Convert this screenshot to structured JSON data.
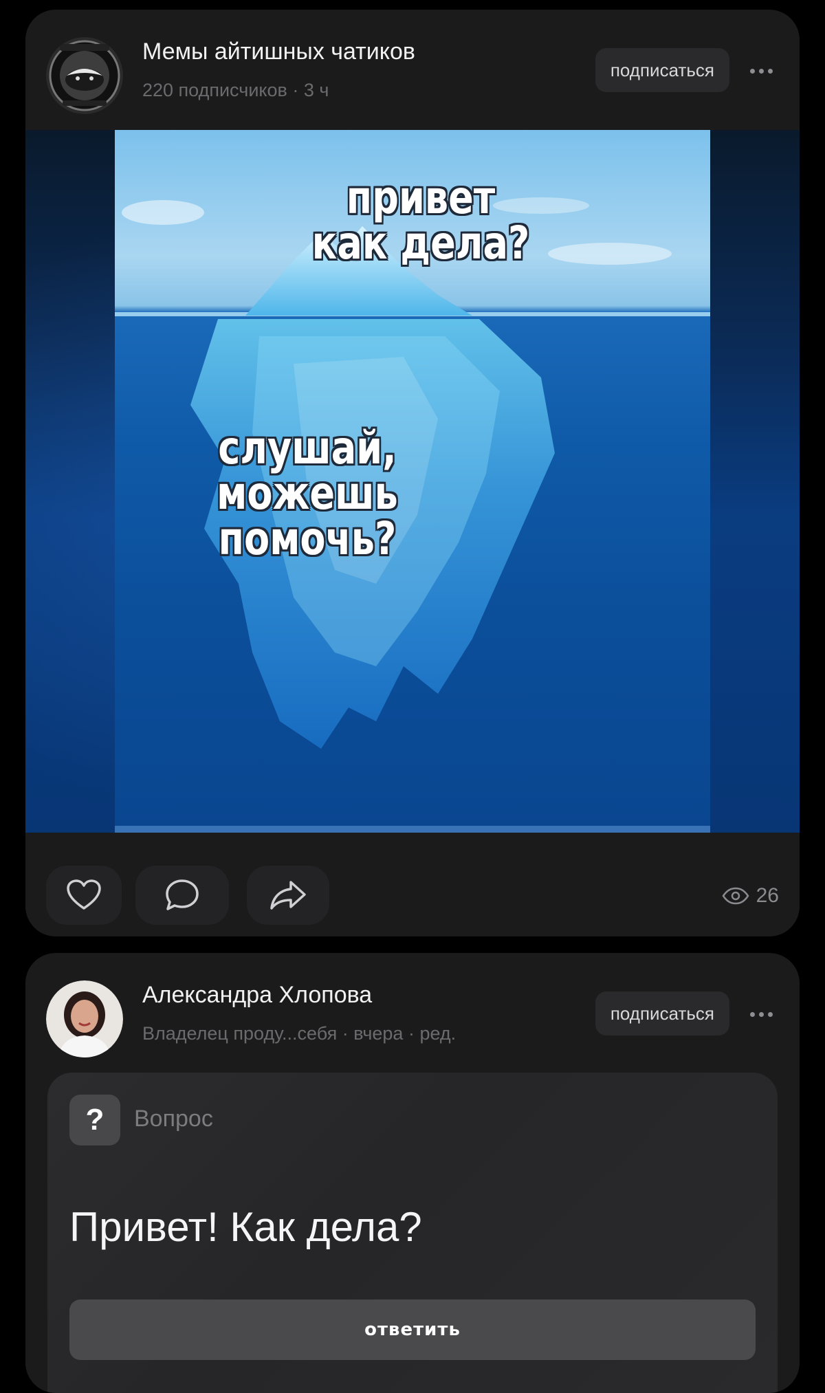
{
  "feed": {
    "posts": [
      {
        "author_name": "Мемы айтишных чатиков",
        "author_meta": "220 подписчиков · 3 ч",
        "avatar_icon": "honey-badger-logo",
        "subscribe_label": "подписаться",
        "more_icon": "more-dots-icon",
        "media": {
          "top_text": "привет\nкак дела?",
          "bottom_text": "слушай, можешь\nпомочь?"
        },
        "actions": {
          "like_icon": "heart-icon",
          "comment_icon": "comment-bubble-icon",
          "share_icon": "share-arrow-icon"
        },
        "views_icon": "eye-icon",
        "views_count": "26"
      },
      {
        "author_name": "Александра Хлопова",
        "author_meta": "Владелец проду...себя · вчера · ред.",
        "avatar_icon": "user-photo",
        "subscribe_label": "подписаться",
        "more_icon": "more-dots-icon",
        "question": {
          "badge": "?",
          "label": "Вопрос",
          "text": "Привет! Как дела?",
          "answer_label": "ответить"
        }
      }
    ]
  },
  "colors": {
    "background": "#000000",
    "card": "#1b1b1c",
    "button": "#2a2a2c",
    "muted_text": "#6b6b6e",
    "ocean": "#0b4e9a"
  }
}
